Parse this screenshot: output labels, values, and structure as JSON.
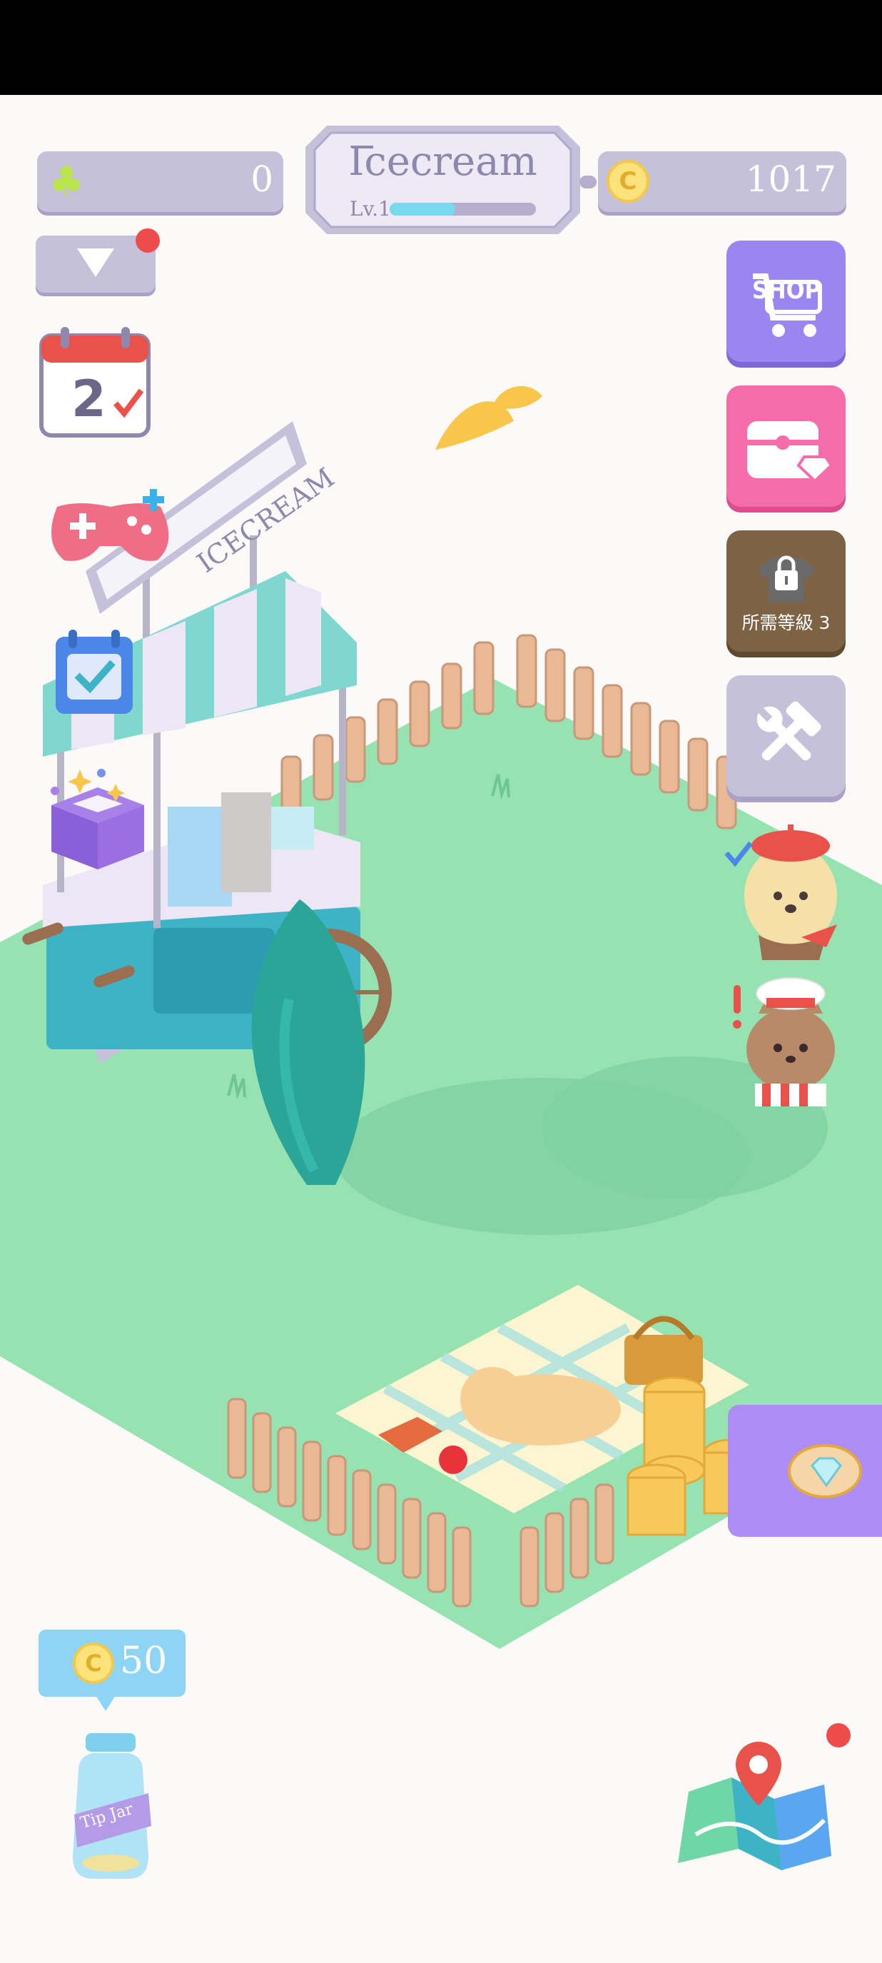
{
  "hud": {
    "clover_count": "0",
    "shop_name": "Icecream",
    "level_label": "Lv.1",
    "level_progress": 0.45,
    "coin_count": "1017"
  },
  "buttons": {
    "shop_label": "SHOP",
    "locked_item_label": "所需等級 3"
  },
  "calendar": {
    "day": "2"
  },
  "cart_sign": "ICECREAM",
  "tip_jar": {
    "amount": "50",
    "jar_label": "Tip Jar"
  },
  "colors": {
    "grass": "#96e3b1",
    "hud_purple": "#c6c1da",
    "shop_button": "#9b85f2",
    "chest_button": "#f56cab",
    "locked_button": "#7d6343",
    "tools_button": "#c6c1da",
    "notification_dot": "#ee4b4b"
  }
}
